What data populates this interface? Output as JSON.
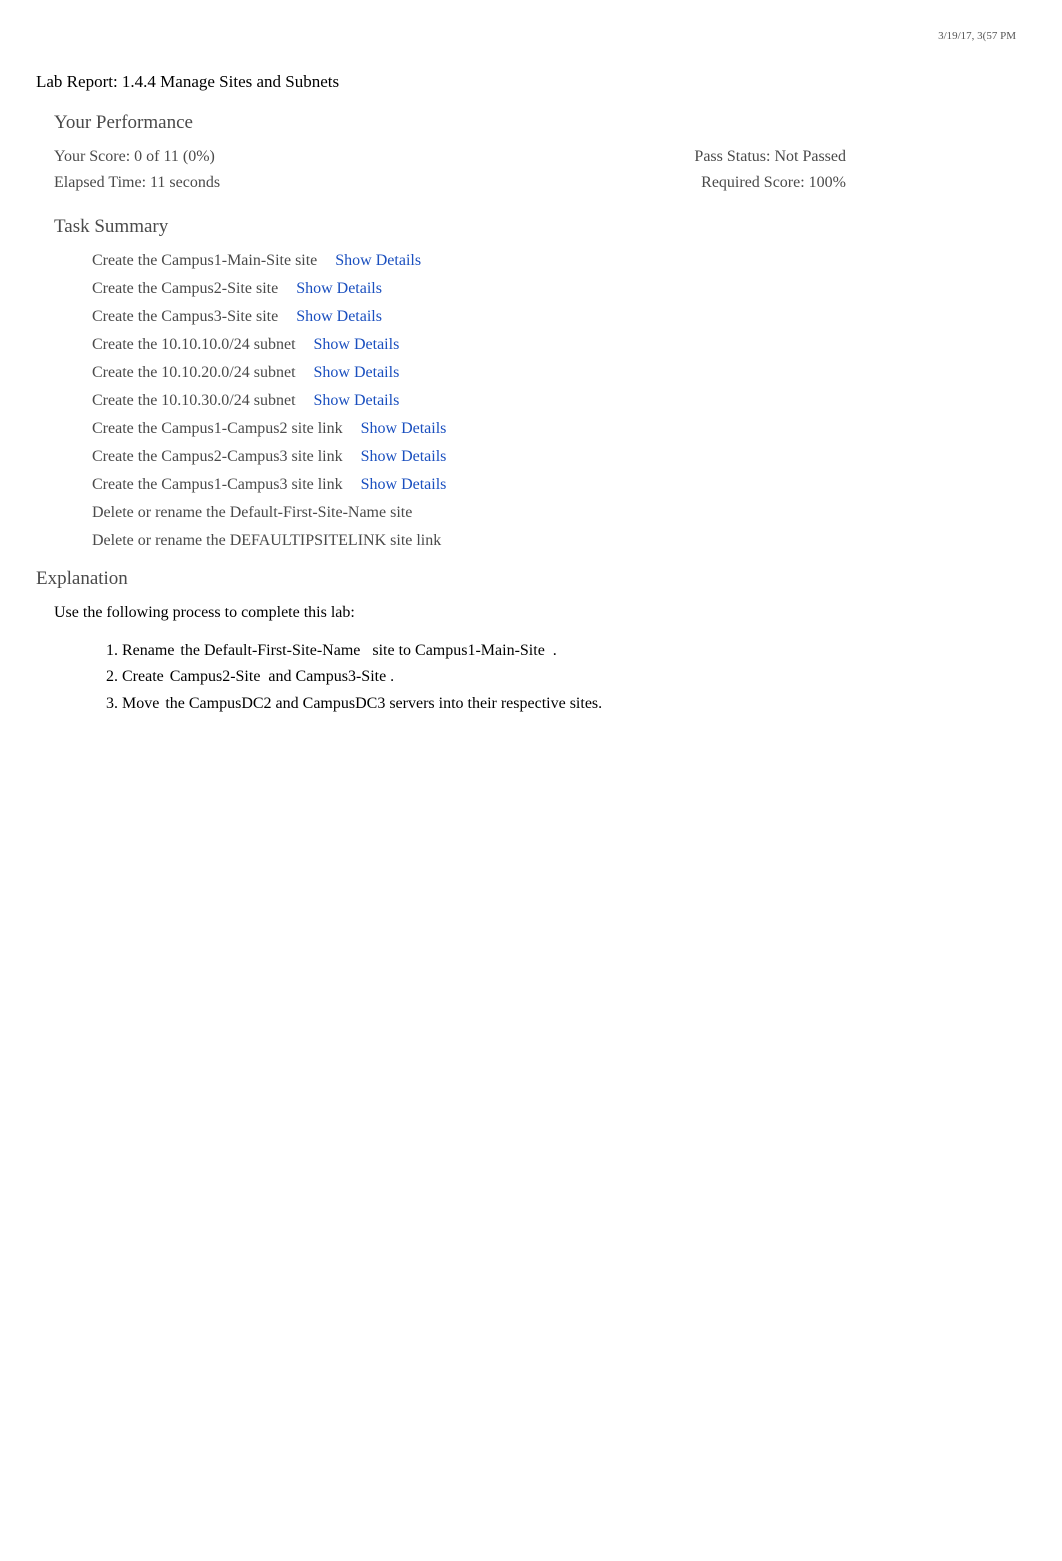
{
  "timestamp": "3/19/17, 3(57 PM",
  "report_title": "Lab Report: 1.4.4 Manage Sites and Subnets",
  "performance": {
    "heading": "Your Performance",
    "score_label": "Your Score: 0 of 11 (0%)",
    "pass_status": "Pass Status: Not Passed",
    "elapsed_time": "Elapsed Time: 11 seconds",
    "required_score": "Required Score: 100%"
  },
  "task_summary": {
    "heading": "Task Summary",
    "show_details_label": "Show Details",
    "items": [
      {
        "text": "Create the Campus1-Main-Site site",
        "details": true
      },
      {
        "text": "Create the Campus2-Site site",
        "details": true
      },
      {
        "text": "Create the Campus3-Site site",
        "details": true
      },
      {
        "text": "Create the 10.10.10.0/24 subnet",
        "details": true
      },
      {
        "text": "Create the 10.10.20.0/24 subnet",
        "details": true
      },
      {
        "text": "Create the 10.10.30.0/24 subnet",
        "details": true
      },
      {
        "text": "Create the Campus1-Campus2 site link",
        "details": true
      },
      {
        "text": "Create the Campus2-Campus3 site link",
        "details": true
      },
      {
        "text": "Create the Campus1-Campus3 site link",
        "details": true
      },
      {
        "text": "Delete or rename the Default-First-Site-Name site",
        "details": false
      },
      {
        "text": "Delete or rename the DEFAULTIPSITELINK site link",
        "details": false
      }
    ]
  },
  "explanation": {
    "heading": "Explanation",
    "intro": "Use the following process to complete this lab:",
    "steps": [
      {
        "prefix": " Rename ",
        "body": "the Default-First-Site-Name   site to Campus1-Main-Site  ."
      },
      {
        "prefix": " Create ",
        "body": "Campus2-Site   and Campus3-Site ."
      },
      {
        "prefix": "Move ",
        "body": "the CampusDC2 and CampusDC3 servers into their respective sites."
      }
    ]
  }
}
